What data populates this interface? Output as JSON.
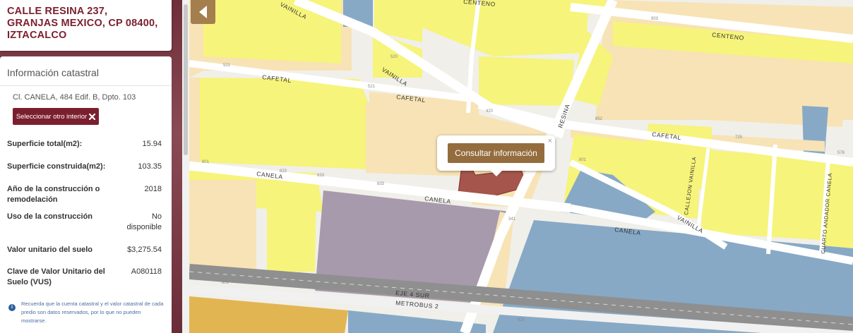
{
  "address": {
    "line1": "CALLE RESINA 237,",
    "line2": "GRANJAS MEXICO, CP 08400,",
    "line3": "IZTACALCO"
  },
  "info": {
    "title": "Información catastral",
    "interior": "Cl. CANELA, 484 Edif. B, Dpto. 103",
    "select_label": "Seleccionar otro interior",
    "select_icon": "close-icon",
    "rows": [
      {
        "label": "Superficie total(m2):",
        "value": "15.94"
      },
      {
        "label": "Superficie construida(m2):",
        "value": "103.35"
      },
      {
        "label": "Año de la construcción o remodelación",
        "value": "2018"
      },
      {
        "label": "Uso de la construcción",
        "value": "No disponible"
      },
      {
        "label": "Valor unitario del suelo",
        "value": "$3,275.54"
      },
      {
        "label": "Clave de Valor Unitario del Suelo (VUS)",
        "value": "A080118"
      }
    ],
    "note": "Recuerda que la cuenta catastral y el valor catastral de cada predio son datos reservados, por lo que no pueden mostrarse."
  },
  "map": {
    "collapse_icon": "chevron-left-icon",
    "popup": {
      "button": "Consultar información",
      "close": "×"
    },
    "streets": {
      "centeno_top": "CENTENO",
      "centeno": "CENTENO",
      "vainilla_top": "VAINILLA",
      "vainilla_mid": "VAINILLA",
      "vainilla_right": "VAINILLA",
      "cafetal_left": "CAFETAL",
      "cafetal_mid": "CAFETAL",
      "cafetal_right": "CAFETAL",
      "canela_left": "CANELA",
      "canela_mid": "CANELA",
      "canela_right": "CANELA",
      "resina": "RESINA",
      "callejon": "CALLEJON VAINILLA",
      "cuarto": "CUARTO ANDADOR CANELA",
      "eje4": "EJE 4 SUR",
      "metrobus": "METROBUS 2"
    },
    "numbers": [
      "903",
      "521",
      "520",
      "521",
      "420",
      "852",
      "725",
      "576",
      "801",
      "823",
      "833",
      "833",
      "801",
      "341",
      "825",
      "801",
      "401"
    ],
    "colors": {
      "yellow": "#f6f47a",
      "beige": "#f7e3b5",
      "blue": "#87a9c6",
      "purple": "#a89aad",
      "orange": "#e2b553",
      "selected": "#a5554c",
      "road": "#ffffff",
      "highway": "#8f8f8f"
    }
  }
}
